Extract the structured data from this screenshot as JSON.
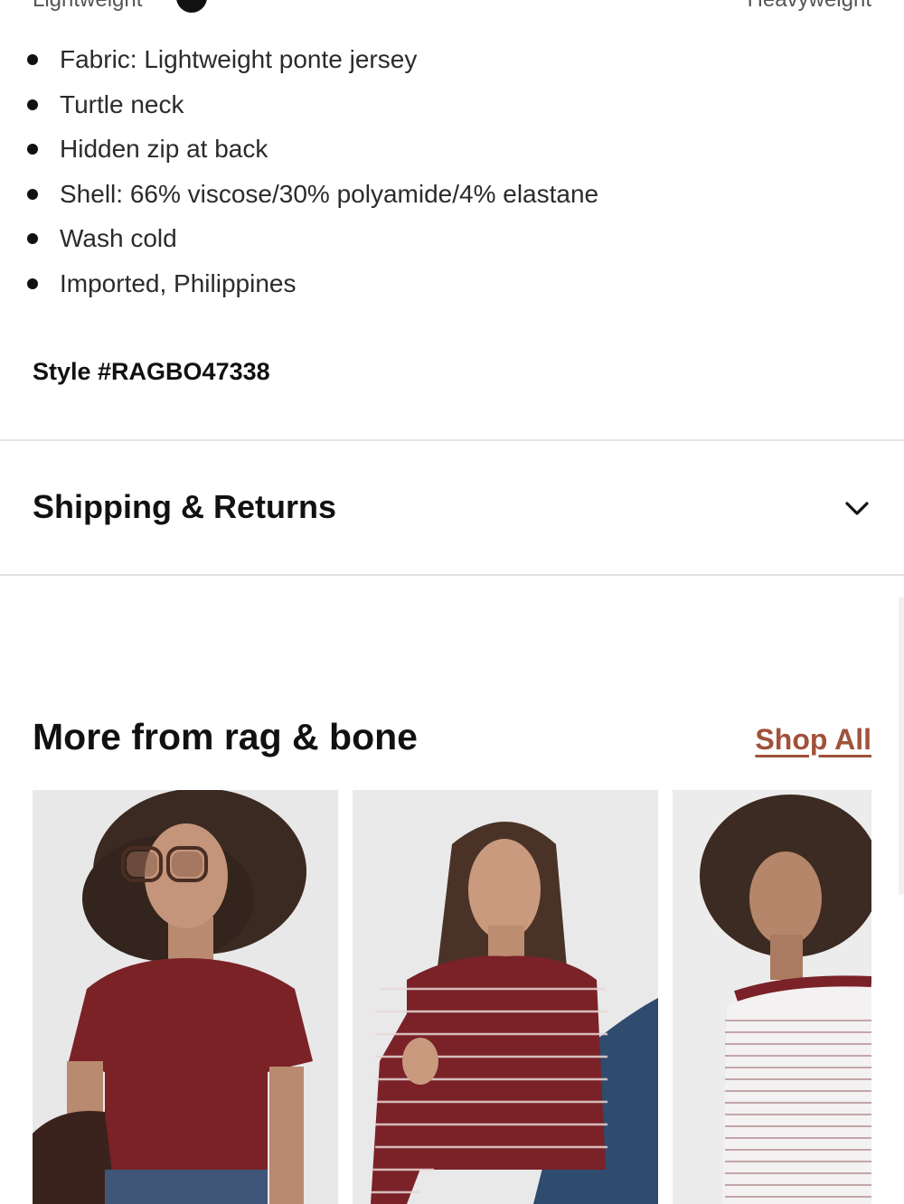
{
  "weight_scale": {
    "left_label": "Lightweight",
    "right_label": "Heavyweight",
    "level": 0.19
  },
  "details": {
    "features": [
      "Fabric: Lightweight ponte jersey",
      "Turtle neck",
      "Hidden zip at back",
      "Shell: 66% viscose/30% polyamide/4% elastane",
      "Wash cold",
      "Imported, Philippines"
    ],
    "style_number": "Style #RAGBO47338"
  },
  "shipping": {
    "title": "Shipping & Returns",
    "icon": "chevron-down-icon"
  },
  "more_from": {
    "title": "More from rag & bone",
    "shop_all_label": "Shop All",
    "accent_color": "#a0523a",
    "products": [
      {
        "image": "model in maroon short-sleeve t-shirt with sunglasses"
      },
      {
        "image": "model in maroon striped long-sleeve tee and jeans"
      },
      {
        "image": "model in white and maroon striped long-sleeve top"
      }
    ]
  }
}
